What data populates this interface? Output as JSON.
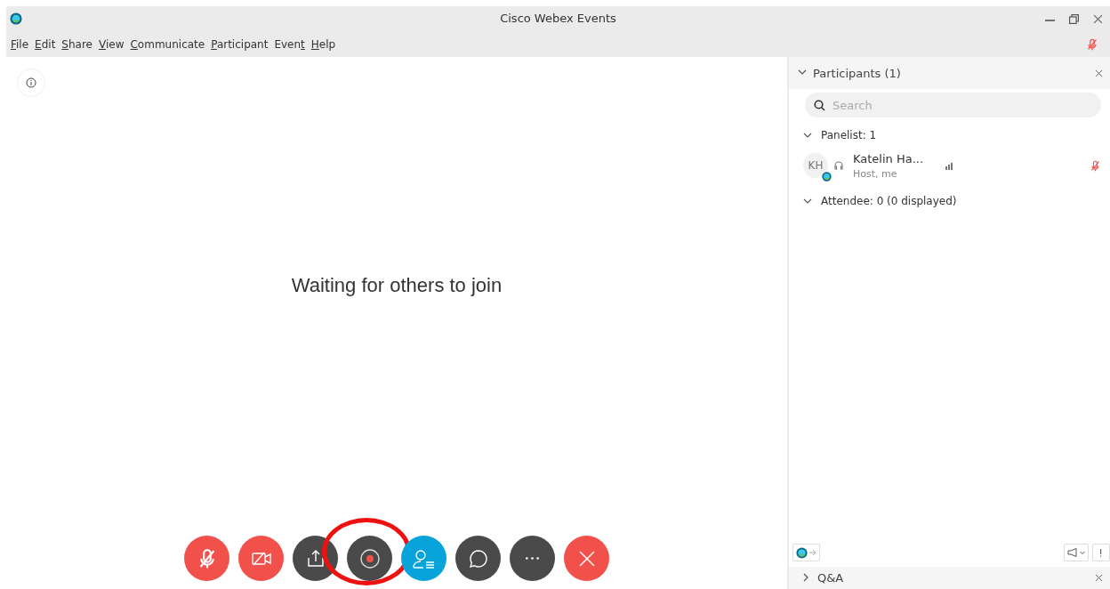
{
  "window": {
    "title": "Cisco Webex Events"
  },
  "menu": [
    {
      "key": "F",
      "post": "ile"
    },
    {
      "key": "E",
      "post": "dit"
    },
    {
      "key": "S",
      "post": "hare"
    },
    {
      "key": "V",
      "post": "iew"
    },
    {
      "key": "C",
      "post": "ommunicate"
    },
    {
      "key": "P",
      "post": "articipant"
    },
    {
      "pre": "Even",
      "key": "t"
    },
    {
      "key": "H",
      "post": "elp"
    }
  ],
  "menu_mic": {
    "muted": true
  },
  "stage": {
    "message": "Waiting for others to join"
  },
  "controls": [
    {
      "kind": "mute",
      "color": "#f2504b",
      "highlighted": false
    },
    {
      "kind": "video",
      "color": "#f2504b",
      "highlighted": false
    },
    {
      "kind": "share",
      "color": "#4a4a4a",
      "highlighted": false
    },
    {
      "kind": "record",
      "color": "#4a4a4a",
      "highlighted": true
    },
    {
      "kind": "participants",
      "color": "#07a3da",
      "highlighted": false
    },
    {
      "kind": "chat",
      "color": "#4a4a4a",
      "highlighted": false
    },
    {
      "kind": "more",
      "color": "#4a4a4a",
      "highlighted": false
    },
    {
      "kind": "leave",
      "color": "#f2504b",
      "highlighted": false
    }
  ],
  "panel": {
    "title": "Participants (1)",
    "expanded": true,
    "search": {
      "placeholder": "Search"
    },
    "groups": [
      {
        "label": "Panelist: 1",
        "expanded": true,
        "members": [
          {
            "initials": "KH",
            "name": "Katelin Ha...",
            "role": "Host, me",
            "muted": true
          }
        ]
      },
      {
        "label": "Attendee: 0 (0 displayed)",
        "expanded": true
      }
    ]
  },
  "qa": {
    "title": "Q&A",
    "expanded": false
  }
}
